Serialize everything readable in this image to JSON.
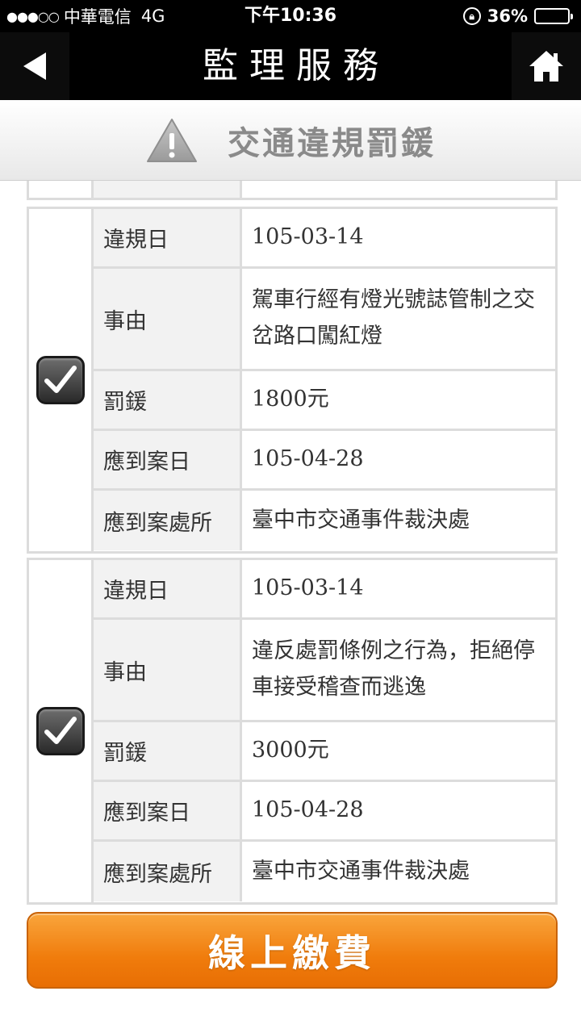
{
  "status_bar": {
    "signal": "●●●○○",
    "carrier": "中華電信",
    "network": "4G",
    "time": "下午10:36",
    "battery": "36%",
    "battery_level": 0.36
  },
  "nav": {
    "title": "監理服務",
    "back_icon": "back-arrow-icon",
    "home_icon": "home-icon"
  },
  "section": {
    "icon": "warning-icon",
    "title": "交通違規罰鍰"
  },
  "records": [
    {
      "checked": true,
      "fields": [
        {
          "label": "違規日",
          "value": "105-03-14"
        },
        {
          "label": "事由",
          "value": "駕車行經有燈光號誌管制之交岔路口闖紅燈"
        },
        {
          "label": "罰鍰",
          "value": "1800元"
        },
        {
          "label": "應到案日",
          "value": "105-04-28"
        },
        {
          "label": "應到案處所",
          "value": "臺中市交通事件裁決處"
        }
      ]
    },
    {
      "checked": true,
      "fields": [
        {
          "label": "違規日",
          "value": "105-03-14"
        },
        {
          "label": "事由",
          "value": "違反處罰條例之行為，拒絕停車接受稽查而逃逸"
        },
        {
          "label": "罰鍰",
          "value": "3000元"
        },
        {
          "label": "應到案日",
          "value": "105-04-28"
        },
        {
          "label": "應到案處所",
          "value": "臺中市交通事件裁決處"
        }
      ]
    }
  ],
  "pay_button": {
    "label": "線上繳費"
  },
  "colors": {
    "nav_background": "#000000",
    "pay_button": "#f28a1c",
    "border": "#dcdcdc",
    "label_background": "#f2f2f2",
    "section_title": "#8a8a8a"
  }
}
